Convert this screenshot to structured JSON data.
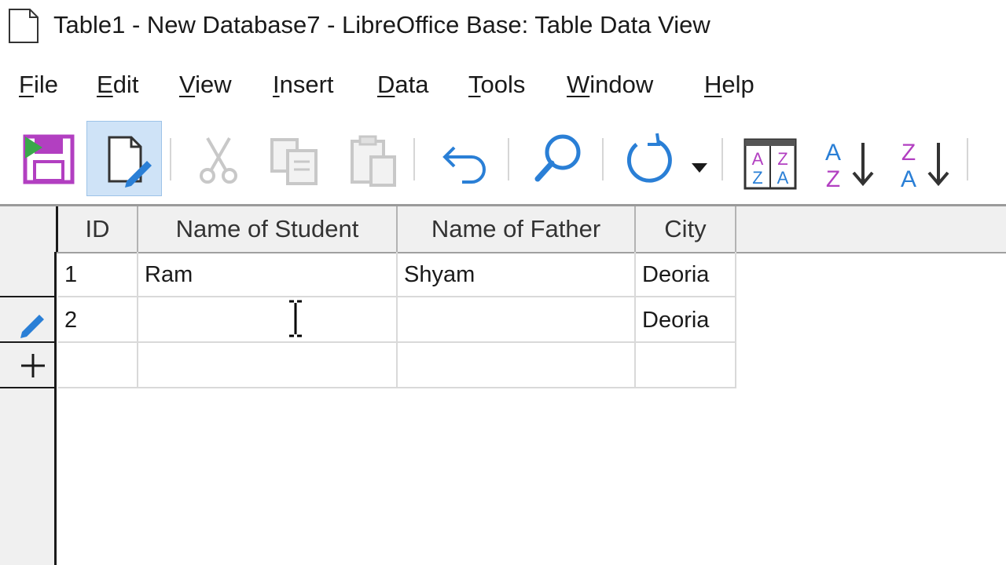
{
  "window": {
    "title": "Table1 - New Database7 - LibreOffice Base: Table Data View"
  },
  "menu": [
    {
      "first": "F",
      "rest": "ile"
    },
    {
      "first": "E",
      "rest": "dit"
    },
    {
      "first": "V",
      "rest": "iew"
    },
    {
      "first": "I",
      "rest": "nsert"
    },
    {
      "first": "D",
      "rest": "ata"
    },
    {
      "first": "T",
      "rest": "ools"
    },
    {
      "first": "W",
      "rest": "indow"
    },
    {
      "first": "H",
      "rest": "elp"
    }
  ],
  "toolbar": {
    "icons": [
      "save-icon",
      "edit-data-icon",
      "cut-icon",
      "copy-icon",
      "paste-icon",
      "undo-icon",
      "find-icon",
      "refresh-icon",
      "dropdown-arrow-icon",
      "sort-icon",
      "sort-ascending-icon",
      "sort-descending-icon"
    ],
    "edit_active": true,
    "colors": {
      "accent": "#2a7fd6",
      "purple": "#b23fc1",
      "green": "#3aa84a"
    }
  },
  "table": {
    "columns": [
      "ID",
      "Name of Student",
      "Name of Father",
      "City"
    ],
    "rows": [
      {
        "id": "1",
        "student": "Ram",
        "father": "Shyam",
        "city": "Deoria",
        "marker": ""
      },
      {
        "id": "2",
        "student": "",
        "father": "",
        "city": "Deoria",
        "marker": "pencil-icon"
      },
      {
        "id": "",
        "student": "",
        "father": "",
        "city": "",
        "marker": "plus-icon"
      }
    ]
  }
}
